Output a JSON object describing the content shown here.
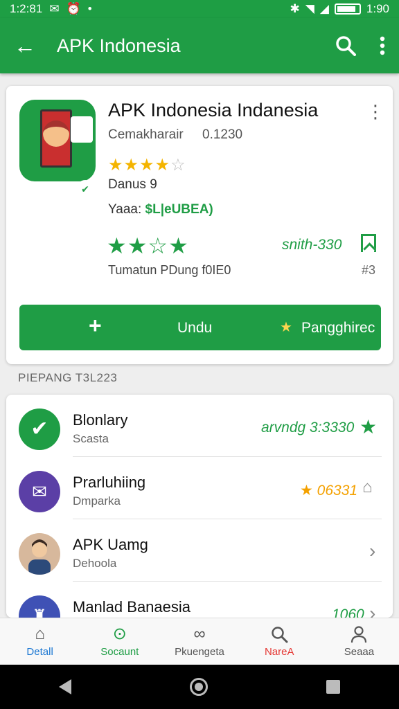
{
  "status_bar": {
    "time": "1:2:81",
    "clock": "1:90"
  },
  "app_bar": {
    "back_icon": "arrow-left-icon",
    "title": "APK Indonesia",
    "search_icon": "search-icon",
    "more_icon": "more-vert-icon"
  },
  "app_card": {
    "title": "APK Indonesia Indanesia",
    "developer": "Cemakharair",
    "version": "0.1230",
    "downloads": "Danus 9",
    "price_label": "Yaaa:",
    "price_value": "$L|eUBEA)",
    "rating_meta": "snith-330",
    "footnote": "Tumatun PDung f0IE0",
    "footnote_count": "#3",
    "install_label": "Undu",
    "wishlist_label": "Pangghirec",
    "stars_gold": 4,
    "stars_total": 5
  },
  "section": {
    "label": "PIEPANG T3L223"
  },
  "list": [
    {
      "name": "Blonlary",
      "sub": "Scasta",
      "meta": "arvndg 3:3330",
      "avatar_color": "#1f9d45",
      "avatar_icon": "checkmark-icon"
    },
    {
      "name": "Prarluhiing",
      "sub": "Dmparka",
      "meta": "★ 06331",
      "avatar_color": "#5b3fa6",
      "avatar_icon": "envelope-icon"
    },
    {
      "name": "APK Uamg",
      "sub": "Dehoola",
      "meta": "",
      "avatar_color": "#6d4c3d",
      "avatar_icon": "person-photo-icon"
    },
    {
      "name": "Manlad Banaesia",
      "sub": "",
      "meta": "1060",
      "avatar_color": "#3f51b5",
      "avatar_icon": "shirt-icon"
    }
  ],
  "bottom_nav": [
    {
      "label": "Detall",
      "icon": "home-icon",
      "color": "#1976d2"
    },
    {
      "label": "Socaunt",
      "icon": "target-icon",
      "color": "#1f9d45"
    },
    {
      "label": "Pkuengeta",
      "icon": "link-icon",
      "color": "#555555"
    },
    {
      "label": "NareA",
      "icon": "search-icon",
      "color": "#e53935"
    },
    {
      "label": "Seaaa",
      "icon": "person-icon",
      "color": "#555555"
    }
  ],
  "colors": {
    "primary": "#1f9d45",
    "star": "#f4b400"
  }
}
